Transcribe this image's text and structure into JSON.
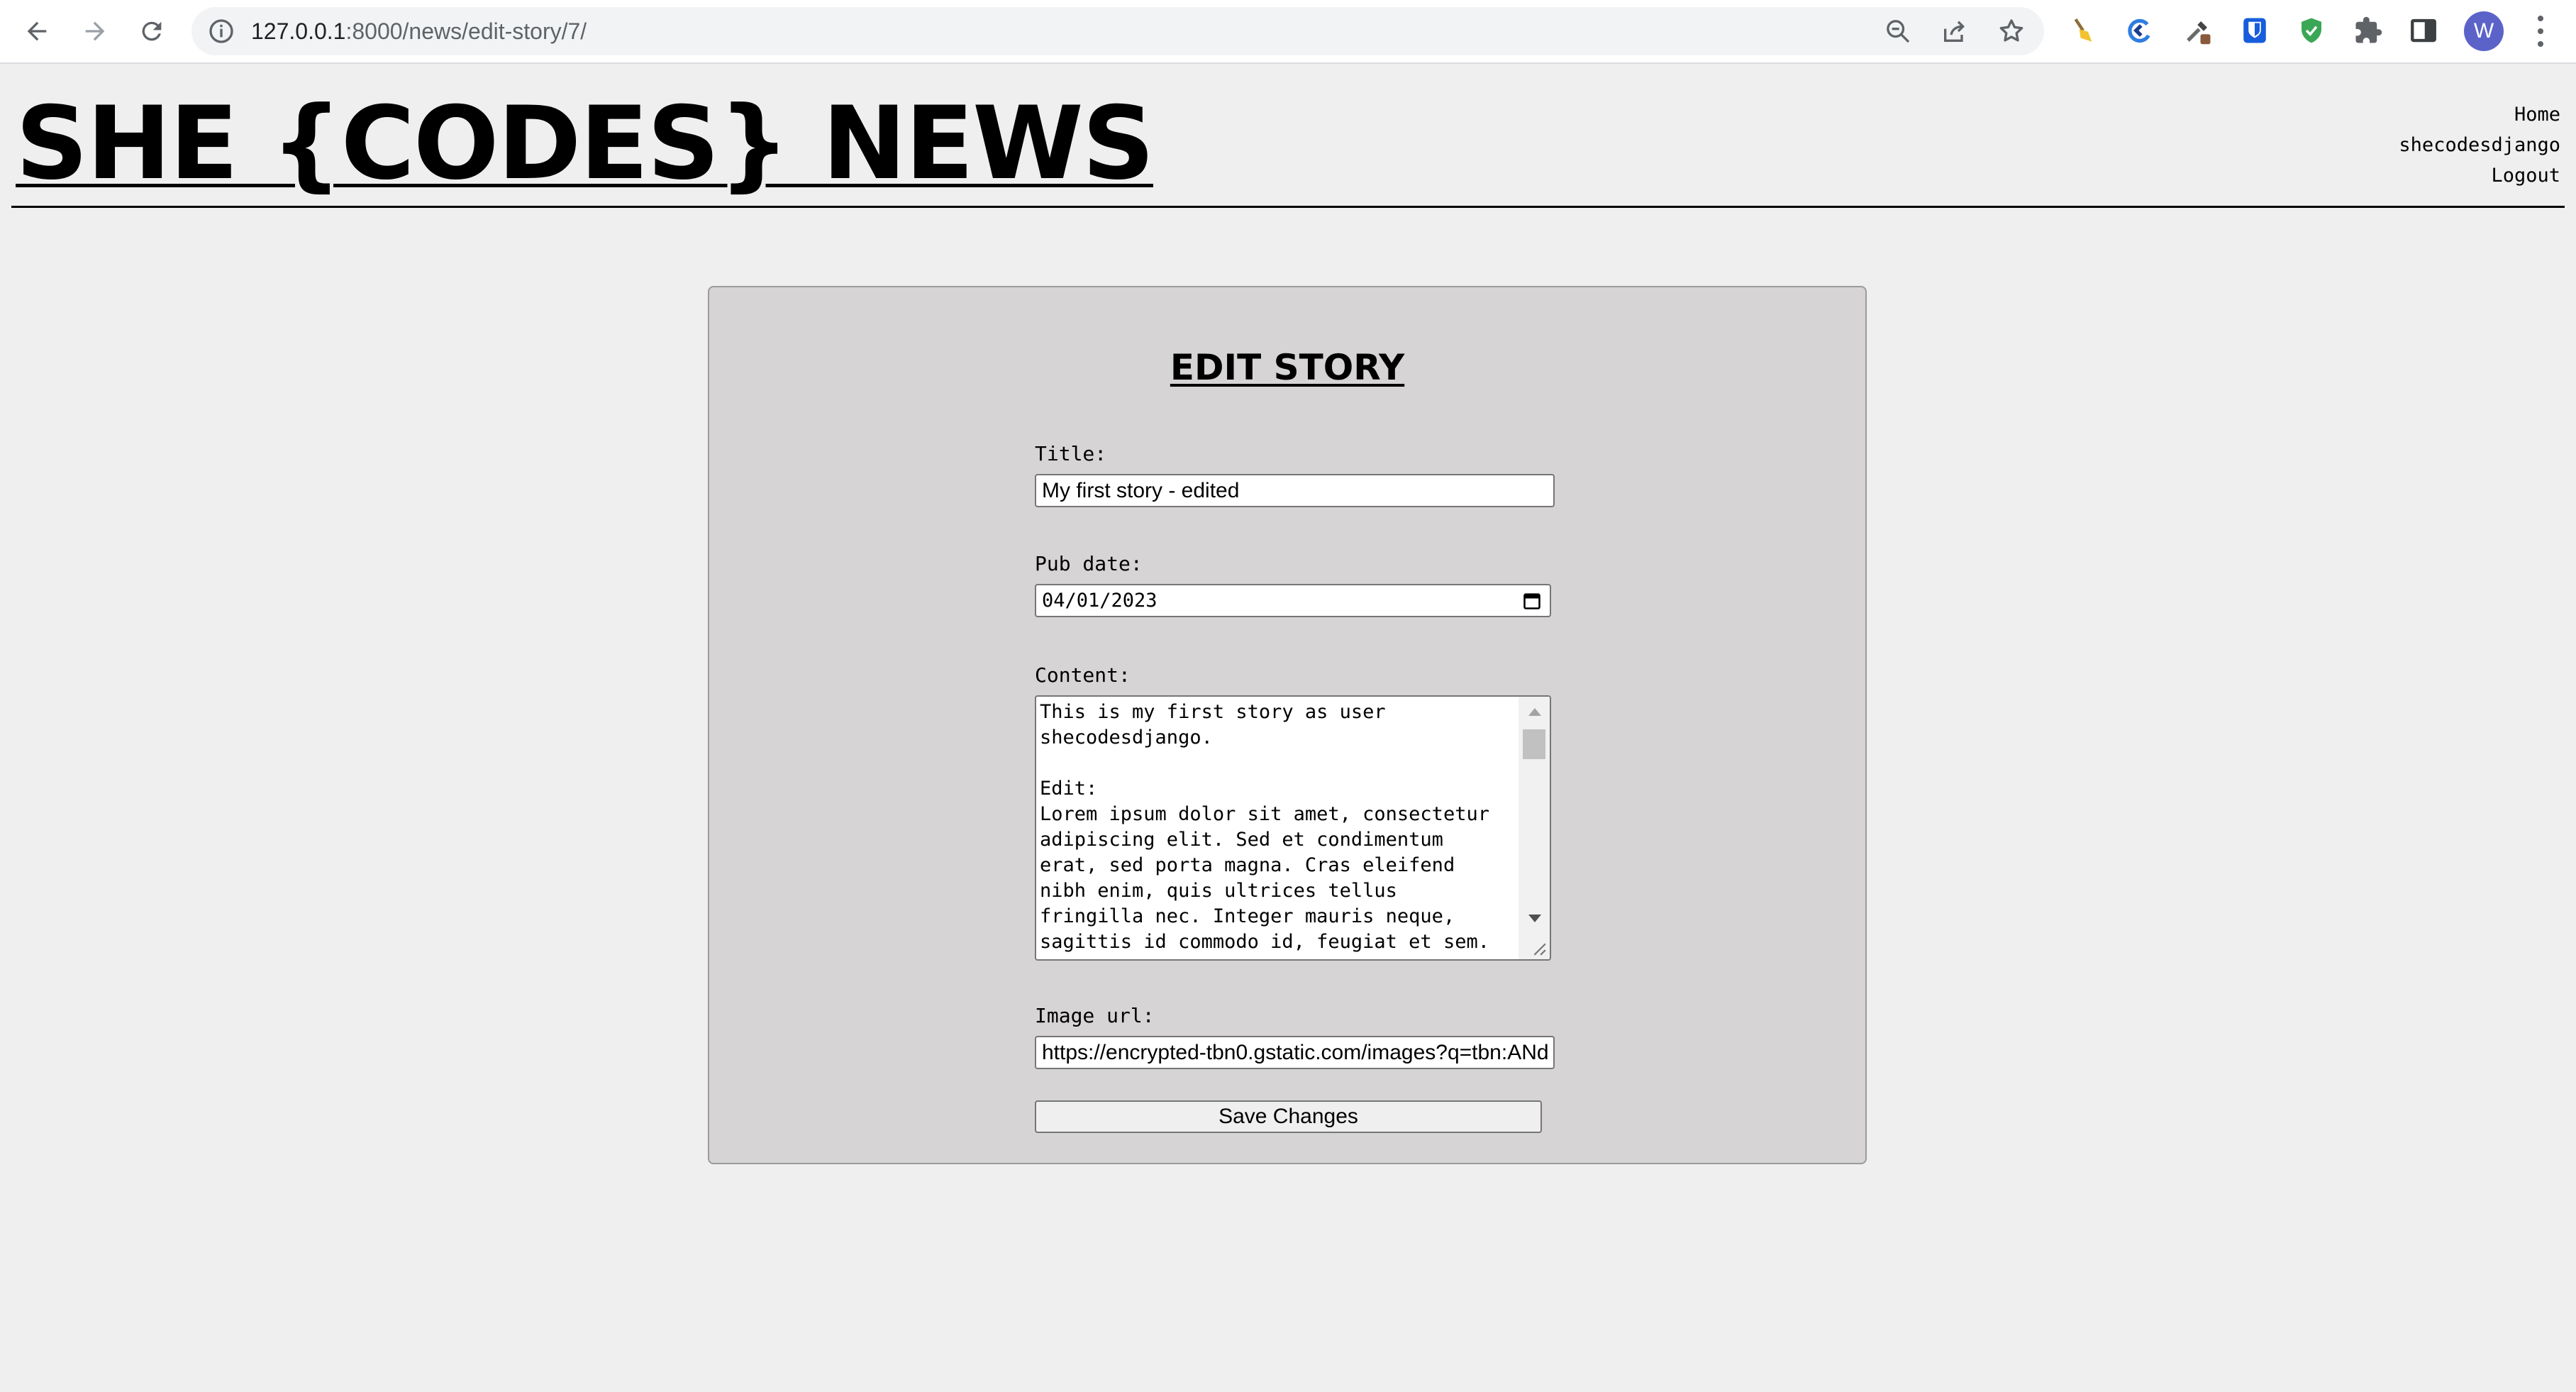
{
  "browser": {
    "url_host": "127.0.0.1",
    "url_path": ":8000/news/edit-story/7/",
    "profile_initial": "W",
    "icons": {
      "back": "arrow-left-icon",
      "forward": "arrow-right-icon",
      "reload": "reload-icon",
      "site_info": "info-icon",
      "zoom": "zoom-out-icon",
      "share": "share-icon",
      "bookmark": "star-icon",
      "extensions": [
        "broom-icon",
        "refresh-arrow-icon",
        "dropper-icon",
        "bitwarden-shield-icon",
        "green-shield-icon",
        "puzzle-icon",
        "side-panel-icon"
      ],
      "menu": "kebab-menu-icon"
    }
  },
  "site": {
    "title": "SHE {CODES} NEWS",
    "nav": {
      "home": "Home",
      "user": "shecodesdjango",
      "logout": "Logout"
    }
  },
  "form": {
    "heading": "EDIT STORY",
    "title_label": "Title:",
    "title_value": "My first story - edited",
    "pub_date_label": "Pub date:",
    "pub_date_value": "04/01/2023",
    "content_label": "Content:",
    "content_value": "This is my first story as user shecodesdjango.\n\nEdit:\nLorem ipsum dolor sit amet, consectetur adipiscing elit. Sed et condimentum erat, sed porta magna. Cras eleifend nibh enim, quis ultrices tellus fringilla nec. Integer mauris neque, sagittis id commodo id, feugiat et sem.",
    "image_url_label": "Image url:",
    "image_url_value": "https://encrypted-tbn0.gstatic.com/images?q=tbn:ANd",
    "submit_label": "Save Changes"
  },
  "colors": {
    "page_background": "#efefef",
    "card_background": "#d6d4d5",
    "text": "#000000"
  }
}
